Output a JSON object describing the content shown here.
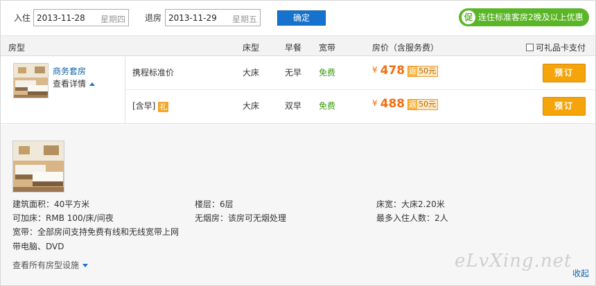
{
  "datebar": {
    "checkin_label": "入住",
    "checkin_date": "2013-11-28",
    "checkin_weekday": "星期四",
    "checkout_label": "退房",
    "checkout_date": "2013-11-29",
    "checkout_weekday": "星期五",
    "confirm_label": "确定",
    "promo_icon": "促",
    "promo_text": "连住标准客房2晚及以上优惠"
  },
  "table_header": {
    "room_type": "房型",
    "bed_type": "床型",
    "breakfast": "早餐",
    "broadband": "宽带",
    "price": "房价（含服务费）",
    "gift_card_pay": "可礼品卡支付"
  },
  "room": {
    "name": "商务套房",
    "details_label": "查看详情",
    "rates": [
      {
        "name": "携程标准价",
        "gift_badge": "",
        "bed": "大床",
        "breakfast": "无早",
        "broadband": "免费",
        "currency": "¥",
        "price": "478",
        "rebate_label": "返",
        "rebate_value": "50元",
        "book_label": "预订"
      },
      {
        "name": "[含早]",
        "gift_badge": "礼",
        "bed": "大床",
        "breakfast": "双早",
        "broadband": "免费",
        "currency": "¥",
        "price": "488",
        "rebate_label": "返",
        "rebate_value": "50元",
        "book_label": "预订"
      }
    ]
  },
  "room_detail": {
    "area": "建筑面积：40平方米",
    "floor": "楼层：6层",
    "bed_width": "床宽：大床2.20米",
    "extra_bed": "可加床：RMB 100/床/间夜",
    "non_smoking": "无烟房：该房可无烟处理",
    "max_guests": "最多入住人数：2人",
    "broadband": "宽带：全部房间支持免费有线和无线宽带上网",
    "computer": "带电脑、DVD",
    "all_facilities_label": "查看所有房型设施",
    "collapse_label": "收起",
    "watermark": "eLvXing.net"
  },
  "colors": {
    "accent_blue": "#1673cd",
    "price_orange": "#f26e10",
    "book_orange": "#f5a40a",
    "promo_green": "#5ab527",
    "free_green": "#3a9a0e"
  }
}
